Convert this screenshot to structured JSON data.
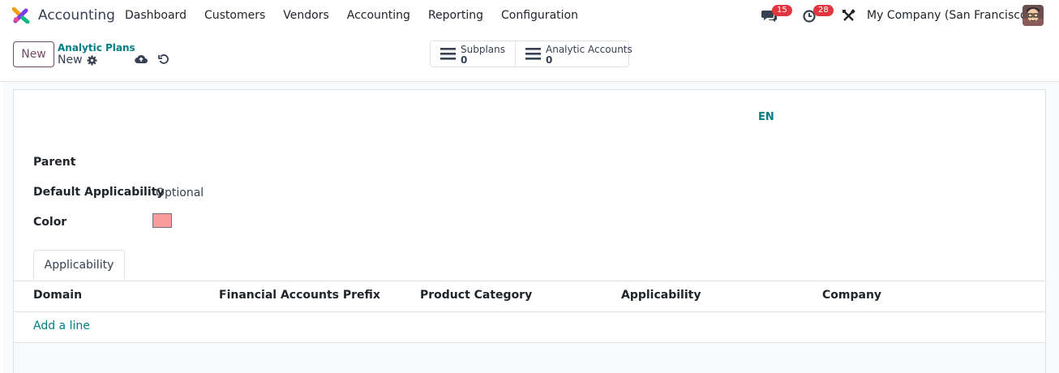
{
  "app": {
    "name": "Accounting",
    "logo_icon": "odoo-accounting-logo-icon"
  },
  "menu": [
    "Dashboard",
    "Customers",
    "Vendors",
    "Accounting",
    "Reporting",
    "Configuration"
  ],
  "systray": {
    "messages_badge": "15",
    "activities_badge": "28",
    "company": "My Company (San Francisco)"
  },
  "control_panel": {
    "new_label": "New",
    "breadcrumb": "Analytic Plans",
    "record_name": "New"
  },
  "smart_buttons": [
    {
      "label": "Subplans",
      "count": "0"
    },
    {
      "label": "Analytic Accounts",
      "count": "0"
    }
  ],
  "form": {
    "lang": "EN",
    "parent_label": "Parent",
    "applicability_label": "Default Applicability",
    "applicability_value": "Optional",
    "color_label": "Color",
    "color_value": "#f79b9b"
  },
  "tabs": [
    "Applicability"
  ],
  "table": {
    "columns": [
      "Domain",
      "Financial Accounts Prefix",
      "Product Category",
      "Applicability",
      "Company"
    ],
    "add_line": "Add a line"
  },
  "colors": {
    "brand": "#714b67",
    "link": "#017e84",
    "badge": "#e0363f"
  }
}
